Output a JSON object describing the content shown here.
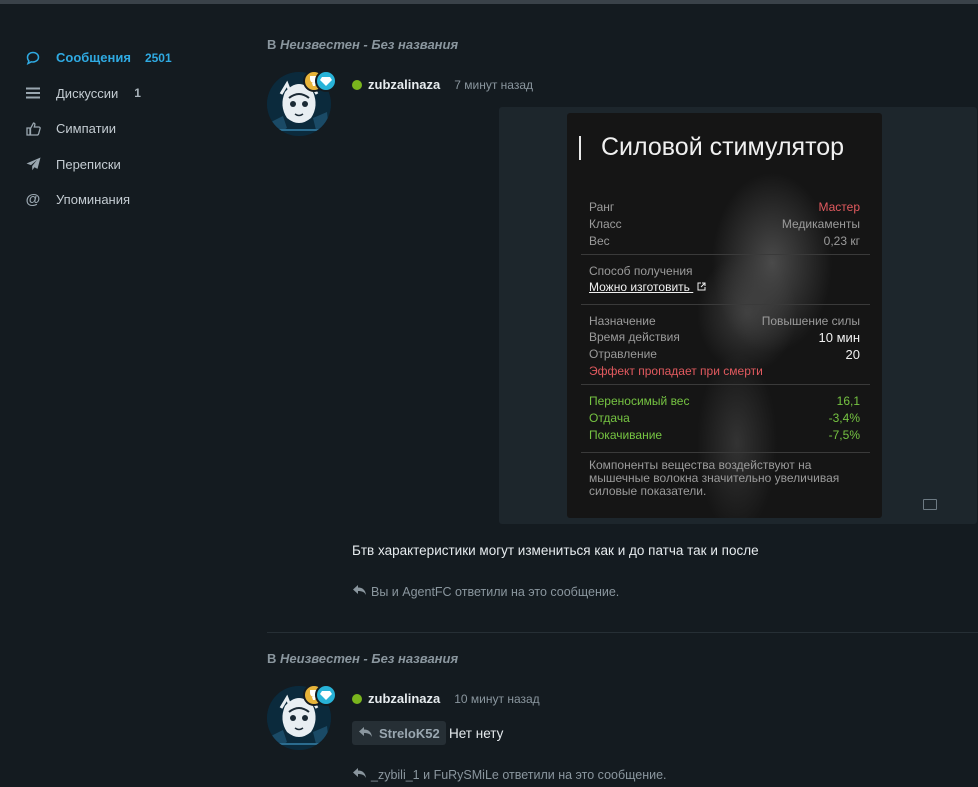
{
  "sidebar": {
    "items": [
      {
        "label": "Сообщения",
        "count": "2501",
        "icon": "chat-bubble-icon",
        "active": true
      },
      {
        "label": "Дискуссии",
        "count": "1",
        "icon": "list-icon",
        "active": false
      },
      {
        "label": "Симпатии",
        "count": "",
        "icon": "thumbs-up-icon",
        "active": false
      },
      {
        "label": "Переписки",
        "count": "",
        "icon": "paper-plane-icon",
        "active": false
      },
      {
        "label": "Упоминания",
        "count": "",
        "icon": "at-sign-icon",
        "active": false
      }
    ]
  },
  "posts": [
    {
      "thread_prefix": "В",
      "thread_title": "Неизвестен - Без названия",
      "username": "zubzalinaza",
      "time": "7 минут назад",
      "body": "Бтв характеристики могут измениться как и до патча так и после",
      "reactions": "Вы и AgentFC ответили на это сообщение."
    },
    {
      "thread_prefix": "В",
      "thread_title": "Неизвестен - Без названия",
      "username": "zubzalinaza",
      "time": "10 минут назад",
      "quote_user": "StreloK52",
      "body": "Нет нету",
      "reactions": "_zybili_1 и FuRySMiLe ответили на это сообщение."
    }
  ],
  "item_card": {
    "title": "Силовой стимулятор",
    "rank_label": "Ранг",
    "rank_value": "Мастер",
    "class_label": "Класс",
    "class_value": "Медикаменты",
    "weight_label": "Вес",
    "weight_value": "0,23 кг",
    "obtain_label": "Способ получения",
    "obtain_link": "Можно изготовить",
    "purpose_label": "Назначение",
    "purpose_value": "Повышение силы",
    "duration_label": "Время действия",
    "duration_value": "10 мин",
    "poison_label": "Отравление",
    "poison_value": "20",
    "death_note": "Эффект пропадает при смерти",
    "stats": [
      {
        "label": "Переносимый вес",
        "value": "16,1"
      },
      {
        "label": "Отдача",
        "value": "-3,4%"
      },
      {
        "label": "Покачивание",
        "value": "-7,5%"
      }
    ],
    "description": "Компоненты вещества воздействуют на мышечные волокна значительно увеличивая силовые показатели."
  },
  "colors": {
    "accent": "#2faae2",
    "online": "#7ab51d",
    "red": "#e25a5f",
    "green": "#76c442"
  }
}
